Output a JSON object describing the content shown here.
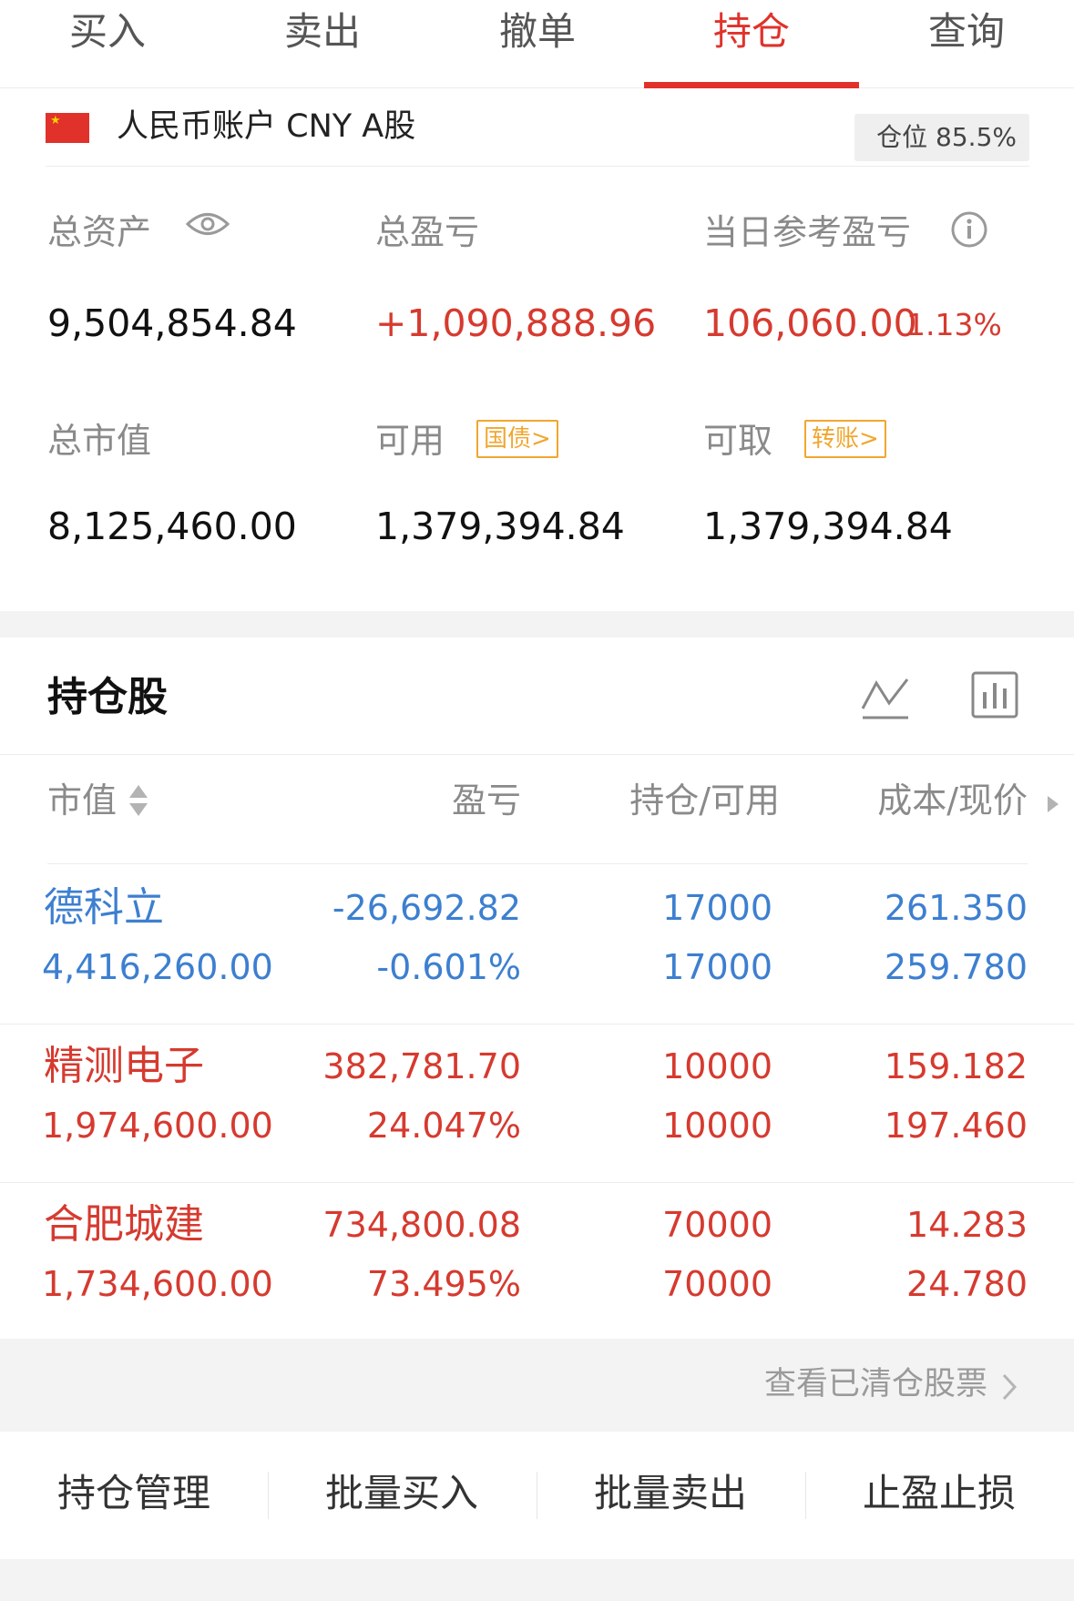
{
  "tabs": [
    {
      "label": "买入"
    },
    {
      "label": "卖出"
    },
    {
      "label": "撤单"
    },
    {
      "label": "持仓"
    },
    {
      "label": "查询"
    }
  ],
  "active_tab": "持仓",
  "account": {
    "title": "人民币账户 CNY A股",
    "position": "仓位 85.5%",
    "total_assets_label": "总资产",
    "total_assets": "9,504,854.84",
    "total_pnl_label": "总盈亏",
    "total_pnl": "+1,090,888.96",
    "daily_pnl_label": "当日参考盈亏",
    "daily_pnl": "106,060.00",
    "daily_pnl_pct": "1.13%",
    "market_value_label": "总市值",
    "market_value": "8,125,460.00",
    "available_label": "可用",
    "available_tag": "国债>",
    "available": "1,379,394.84",
    "withdrawable_label": "可取",
    "withdrawable_tag": "转账>",
    "withdrawable": "1,379,394.84"
  },
  "holdings": {
    "title": "持仓股",
    "columns": [
      "市值",
      "盈亏",
      "持仓/可用",
      "成本/现价"
    ],
    "rows": [
      {
        "name": "德科立",
        "market_value": "4,416,260.00",
        "pnl": "-26,692.82",
        "pnl_pct": "-0.601%",
        "position": "17000",
        "available": "17000",
        "cost": "261.350",
        "price": "259.780",
        "trend": "down"
      },
      {
        "name": "精测电子",
        "market_value": "1,974,600.00",
        "pnl": "382,781.70",
        "pnl_pct": "24.047%",
        "position": "10000",
        "available": "10000",
        "cost": "159.182",
        "price": "197.460",
        "trend": "up"
      },
      {
        "name": "合肥城建",
        "market_value": "1,734,600.00",
        "pnl": "734,800.08",
        "pnl_pct": "73.495%",
        "position": "70000",
        "available": "70000",
        "cost": "14.283",
        "price": "24.780",
        "trend": "up"
      }
    ]
  },
  "cleared_link": "查看已清仓股票",
  "actions": [
    "持仓管理",
    "批量买入",
    "批量卖出",
    "止盈止损"
  ],
  "colors": {
    "accent": "#e0322b",
    "up": "#d63a2f",
    "down": "#3d7fd0",
    "tag": "#f1a62e"
  }
}
